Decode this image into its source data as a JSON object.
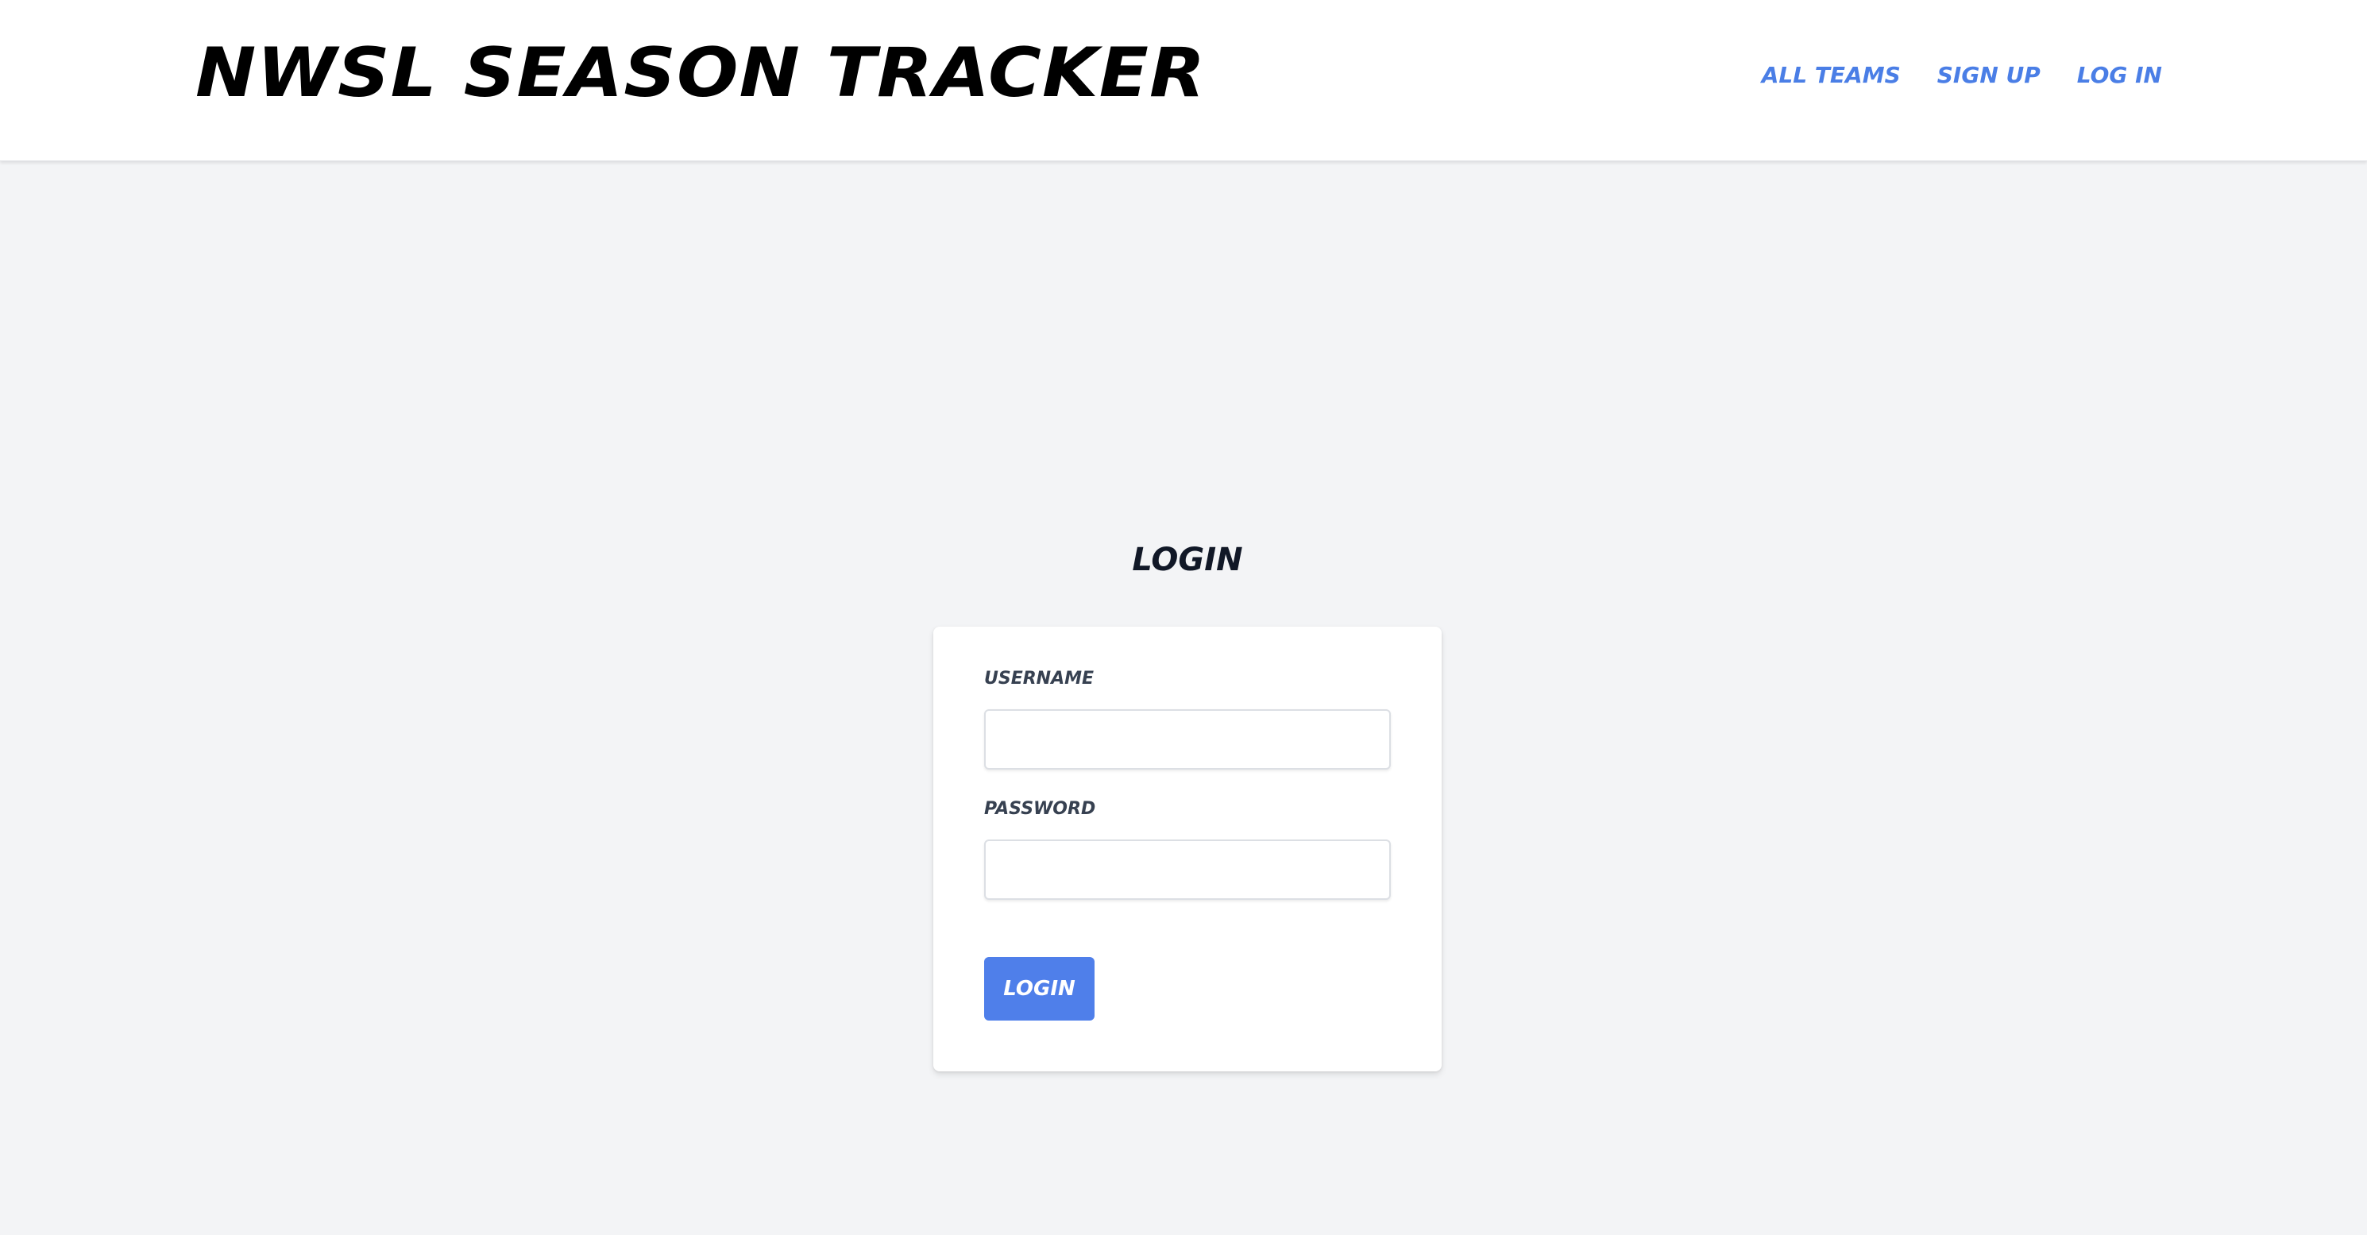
{
  "header": {
    "site_title": "NWSL SEASON TRACKER",
    "nav": [
      {
        "label": "ALL TEAMS"
      },
      {
        "label": "SIGN UP"
      },
      {
        "label": "LOG IN"
      }
    ]
  },
  "login": {
    "heading": "LOGIN",
    "username_label": "USERNAME",
    "username_value": "",
    "password_label": "PASSWORD",
    "password_value": "",
    "submit_label": "LOGIN"
  },
  "colors": {
    "link": "#4a7ee6",
    "button": "#4f7fea",
    "background": "#f3f4f6",
    "title": "#000000"
  }
}
